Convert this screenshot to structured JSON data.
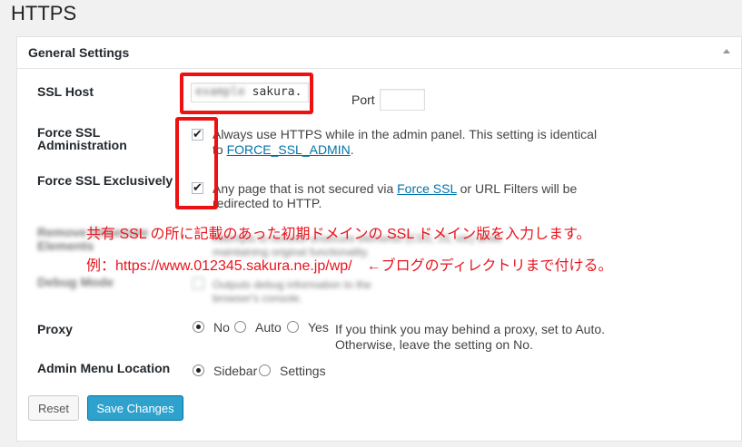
{
  "page": {
    "title": "HTTPS"
  },
  "panel": {
    "title": "General Settings"
  },
  "ssl_host": {
    "label": "SSL Host",
    "value_blurred": "example",
    "value_visible": "sakura.",
    "port_label": "Port",
    "port_value": ""
  },
  "force_admin": {
    "label_line1": "Force SSL",
    "label_line2": "Administration",
    "checked": true,
    "desc_line1": "Always use HTTPS while in the admin panel. This setting is identical",
    "desc_line2_prefix": "to ",
    "desc_link": "FORCE_SSL_ADMIN",
    "desc_line2_suffix": "."
  },
  "force_exclusive": {
    "label": "Force SSL Exclusively",
    "checked": true,
    "desc_line1_prefix": "Any page that is not secured via ",
    "desc_link": "Force SSL",
    "desc_line1_suffix": " or URL Filters will be",
    "desc_line2": "redirected to HTTP."
  },
  "remove_unsecure": {
    "label_line1": "Remove Unsecure",
    "label_line2": "Elements",
    "desc_line1": "Attempts to remove unsecure elements (CSS, JS, etc) while",
    "desc_line2": "maintaining original functionality."
  },
  "debug": {
    "label": "Debug Mode",
    "desc_line1": "Outputs debug information to the",
    "desc_line2": "browser's console."
  },
  "proxy": {
    "label": "Proxy",
    "options": [
      "No",
      "Auto",
      "Yes"
    ],
    "selected": "No",
    "desc_line1": "If you think you may behind a proxy, set to Auto.",
    "desc_line2": "Otherwise, leave the setting on No."
  },
  "admin_menu": {
    "label": "Admin Menu Location",
    "options": [
      "Sidebar",
      "Settings"
    ],
    "selected": "Sidebar"
  },
  "buttons": {
    "reset": "Reset",
    "save": "Save Changes"
  },
  "annotation": {
    "line1": "共有 SSL の所に記載のあった初期ドメインの SSL ドメイン版を入力します。",
    "line2": "例：https://www.012345.sakura.ne.jp/wp/　←ブログのディレクトリまで付ける。",
    "color": "#e8131d"
  },
  "colors": {
    "link": "#0073aa",
    "primary_button": "#2ea2cc",
    "highlight_box": "#ee1111"
  }
}
